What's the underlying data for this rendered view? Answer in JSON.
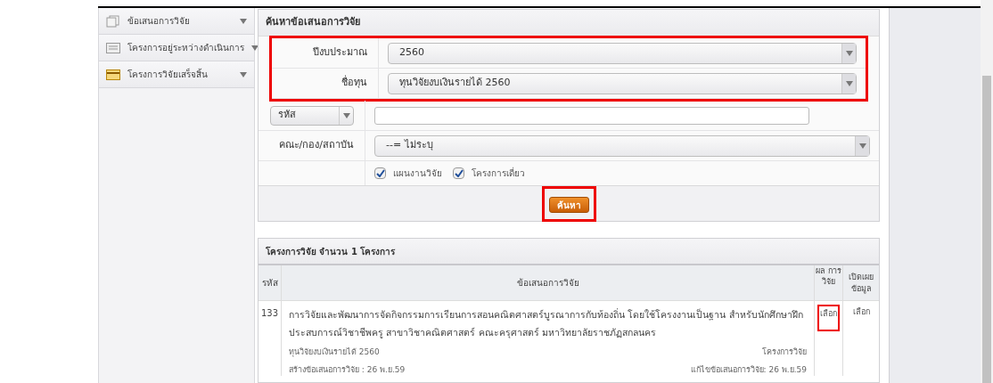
{
  "sidebar": {
    "items": [
      {
        "label": "ข้อเสนอการวิจัย",
        "kind": "stack",
        "selected": false
      },
      {
        "label": "โครงการอยู่ระหว่างดำเนินการ",
        "kind": "list",
        "selected": false
      },
      {
        "label": "โครงการวิจัยเสร็จสิ้น",
        "kind": "card",
        "selected": false
      }
    ]
  },
  "search_panel": {
    "title": "ค้นหาข้อเสนอการวิจัย",
    "fields": [
      {
        "kind": "select",
        "label": "ปีงบประมาณ",
        "value": "2560",
        "highlighted": true
      },
      {
        "kind": "select",
        "label": "ชื่อทุน",
        "value": "ทุนวิจัยงบเงินรายได้ 2560",
        "highlighted": true
      },
      {
        "kind": "keyed_text",
        "key": "รหัส",
        "highlighted": false
      },
      {
        "kind": "select",
        "label": "คณะ/กอง/สถาบัน",
        "value": "--= ไม่ระบุ",
        "highlighted": false
      }
    ],
    "checkboxes": [
      {
        "label": "แผนงานวิจัย",
        "checked": true
      },
      {
        "label": "โครงการเดี่ยว",
        "checked": true
      }
    ],
    "search_button": {
      "label": "ค้นหา",
      "highlighted": true
    }
  },
  "results": {
    "title": "โครงการวิจัย จำนวน 1 โครงการ",
    "columns": [
      "รหัส",
      "ข้อเสนอการวิจัย",
      "ผล การ วิจัย",
      "เปิดเผย ข้อมูล"
    ],
    "rows": [
      {
        "code": "133",
        "title": "การวิจัยและพัฒนาการจัดกิจกรรมการเรียนการสอนคณิตศาสตร์บูรณาการกับท้องถิ่น โดยใช้โครงงานเป็นฐาน สำหรับนักศึกษาฝึกประสบการณ์วิชาชีพครู  สาขาวิชาคณิตศาสตร์ คณะครุศาสตร์  มหาวิทยาลัยราชภัฏสกลนคร",
        "fund": "ทุนวิจัยงบเงินรายได้ 2560",
        "type": "โครงการวิจัย",
        "created": "สร้างข้อเสนอการวิจัย : 26 พ.ย.59",
        "edited": "แก้ไขข้อเสนอการวิจัย: 26 พ.ย.59",
        "result_link": "เลือก",
        "result_highlighted": true,
        "disclose_link": "เลือก"
      }
    ]
  }
}
